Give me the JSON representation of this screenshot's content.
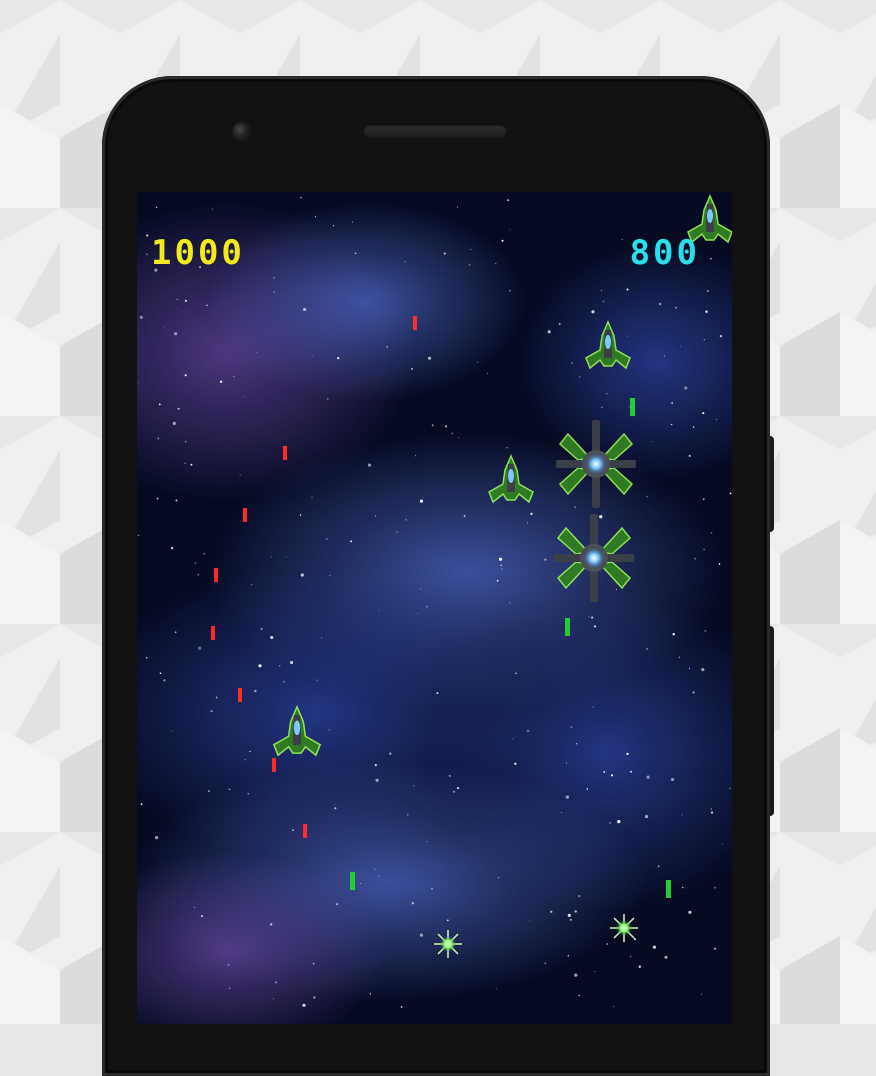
{
  "hud": {
    "player_score": "1000",
    "enemy_score": "800"
  },
  "colors": {
    "player_score": "#f2ea1f",
    "enemy_score": "#29e0ea",
    "player_laser": "#ff2a2a",
    "enemy_laser": "#22cc33",
    "ship_hull": "#3a9a2a",
    "engine_glow": "#7fc8ff"
  },
  "icons": {
    "ship": "fighter-ship-icon",
    "boss": "x-wing-boss-icon",
    "mine": "star-mine-icon"
  }
}
